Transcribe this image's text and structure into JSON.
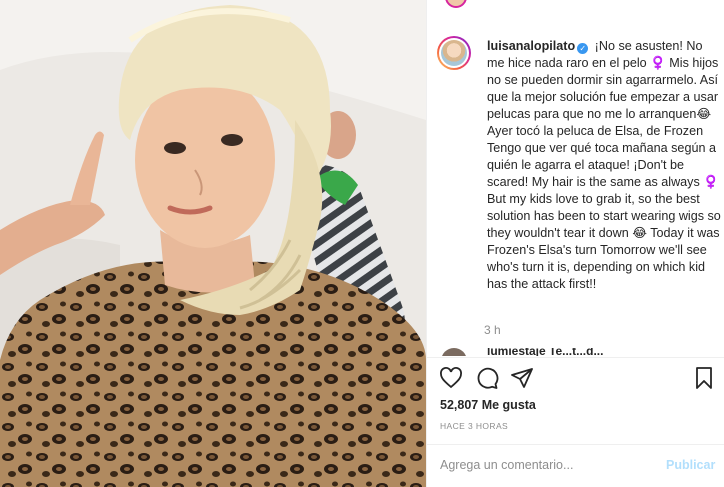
{
  "post": {
    "username": "luisanalopilato",
    "caption": "¡No se asusten! No me hice nada raro en el pelo ♀️ Mis hijos no se pueden dormir sin agarrarmelo. Así que la mejor solución fue empezar a usar pelucas para que no me lo arranquen😂 Ayer tocó la peluca de Elsa, de Frozen  Tengo que ver qué toca mañana según a quién le agarra el ataque!  ¡Don't be scared! My hair is the same as always ♀️ But my kids love to grab it, so the best solution has been to start wearing wigs so they wouldn't tear it down 😂 Today it was Frozen's Elsa's turn  Tomorrow we'll see who's turn it is, depending on which kid has the attack first!! ",
    "time_ago": "3 h",
    "next_comment_peek": "lumiestaje   Te...t...d..."
  },
  "actions": {
    "like_icon": "heart-icon",
    "comment_icon": "comment-bubble-icon",
    "share_icon": "share-paper-plane-icon",
    "save_icon": "bookmark-icon"
  },
  "stats": {
    "likes": "52,807 Me gusta",
    "date": "HACE 3 HORAS"
  },
  "comment_box": {
    "placeholder": "Agrega un comentario...",
    "publish_label": "Publicar"
  },
  "colors": {
    "verified": "#3897f0",
    "publish_disabled": "#b2dffc",
    "muted_text": "#8e8e8e"
  }
}
